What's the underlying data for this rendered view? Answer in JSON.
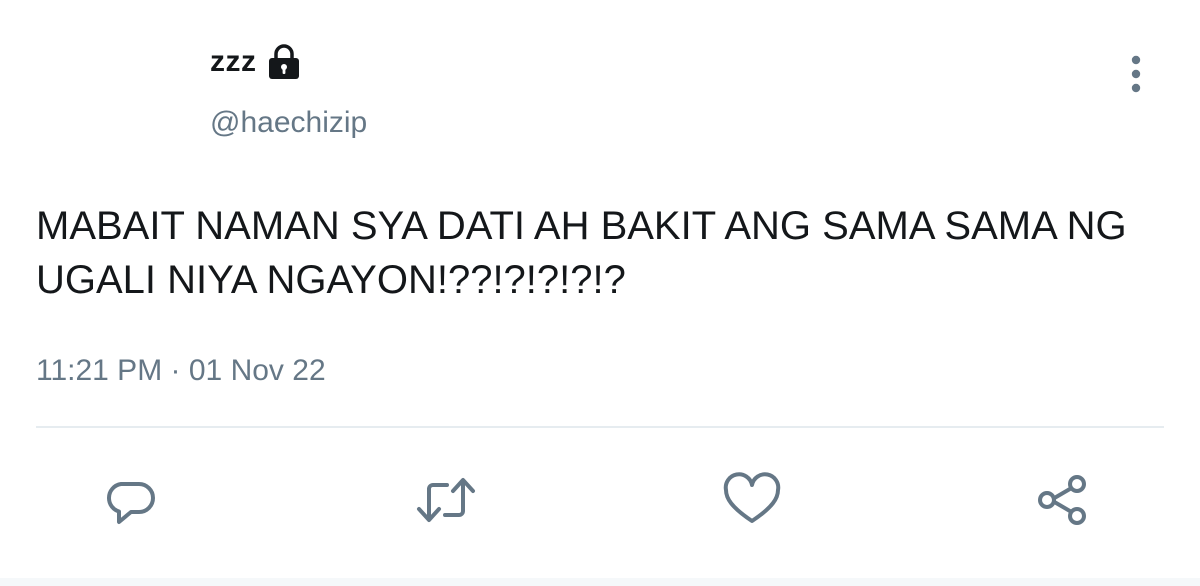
{
  "tweet": {
    "display_name": "zzz",
    "handle": "@haechizip",
    "text": "MABAIT NAMAN SYA DATI AH BAKIT ANG SAMA SAMA NG UGALI NIYA NGAYON!??!?!?!?!?",
    "time": "11:21 PM",
    "separator": "·",
    "date": "01 Nov 22"
  },
  "icons": {
    "lock": "lock-icon",
    "more": "more-vertical-icon",
    "reply": "reply-icon",
    "retweet": "retweet-icon",
    "like": "heart-icon",
    "share": "share-icon"
  },
  "colors": {
    "text": "#14171a",
    "secondary": "#657786",
    "divider": "#e6ecf0"
  }
}
